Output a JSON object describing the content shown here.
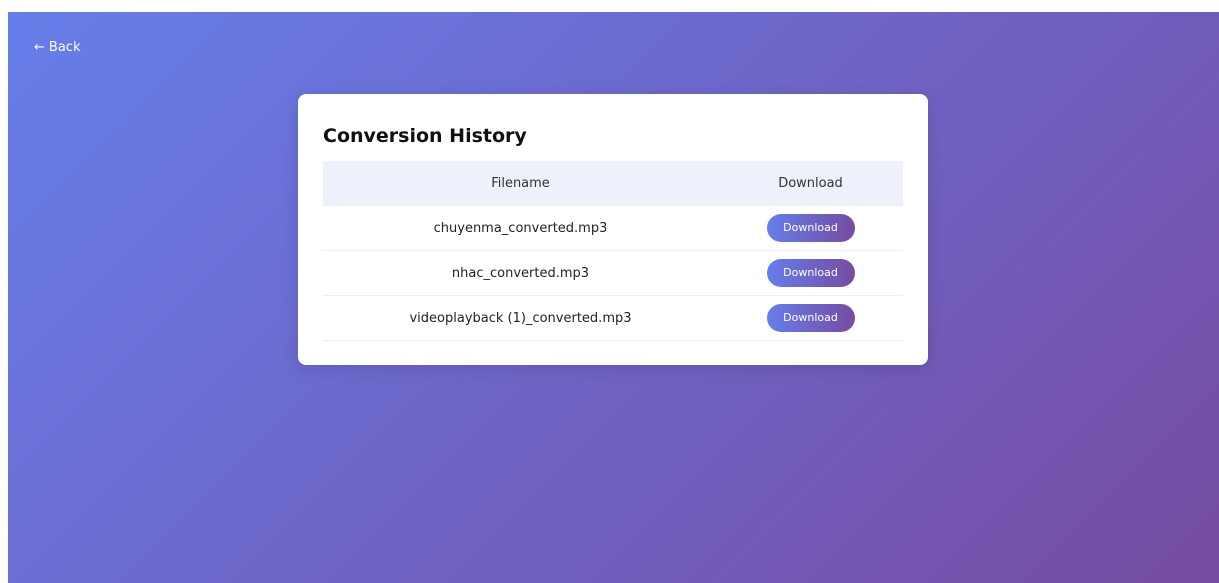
{
  "nav": {
    "back_label": "Back",
    "back_arrow": "←"
  },
  "card": {
    "title": "Conversion History",
    "columns": {
      "filename": "Filename",
      "download": "Download"
    },
    "rows": [
      {
        "filename": "chuyenma_converted.mp3",
        "button_label": "Download"
      },
      {
        "filename": "nhac_converted.mp3",
        "button_label": "Download"
      },
      {
        "filename": "videoplayback (1)_converted.mp3",
        "button_label": "Download"
      }
    ]
  },
  "colors": {
    "gradient_start": "#667eea",
    "gradient_end": "#764ba2",
    "header_row_bg": "#eef0fb"
  }
}
